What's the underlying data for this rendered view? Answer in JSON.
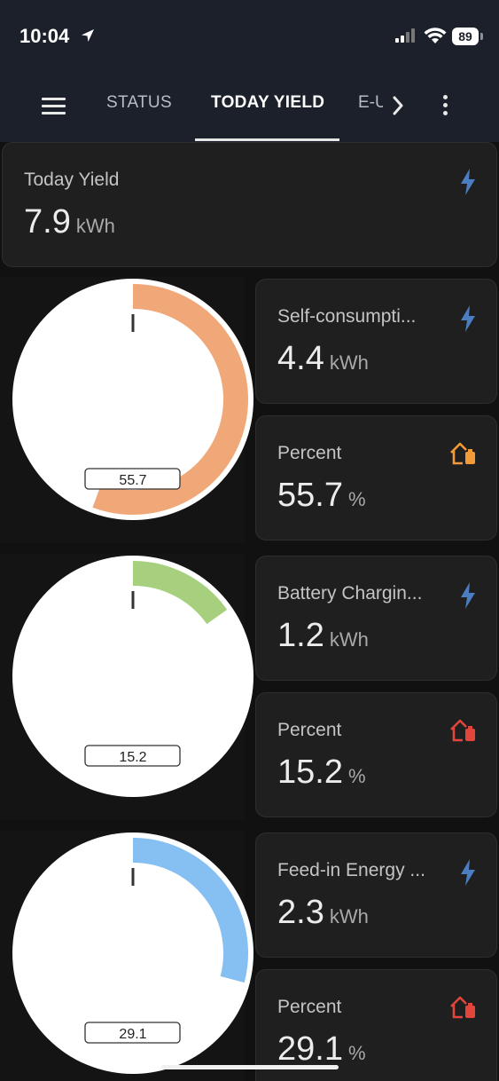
{
  "status_bar": {
    "time": "10:04",
    "battery": "89"
  },
  "app_bar": {
    "tabs": [
      {
        "label": "STATUS",
        "active": false
      },
      {
        "label": "TODAY YIELD",
        "active": true
      },
      {
        "label": "E-U",
        "active": false
      }
    ]
  },
  "summary": {
    "title": "Today Yield",
    "value": "7.9",
    "unit": "kWh",
    "icon": "lightning-icon"
  },
  "sections": [
    {
      "gauge": {
        "value": 55.7,
        "label": "55.7",
        "color": "#f0a878"
      },
      "energy": {
        "title": "Self-consumpti...",
        "value": "4.4",
        "unit": "kWh",
        "icon": "lightning-icon",
        "icon_color": "#4a7ec0"
      },
      "percent": {
        "title": "Percent",
        "value": "55.7",
        "unit": "%",
        "icon": "home-battery-icon",
        "icon_color": "#f29a38"
      }
    },
    {
      "gauge": {
        "value": 15.2,
        "label": "15.2",
        "color": "#a6d07e"
      },
      "energy": {
        "title": "Battery Chargin...",
        "value": "1.2",
        "unit": "kWh",
        "icon": "lightning-icon",
        "icon_color": "#4a7ec0"
      },
      "percent": {
        "title": "Percent",
        "value": "15.2",
        "unit": "%",
        "icon": "home-battery-icon",
        "icon_color": "#e2463b"
      }
    },
    {
      "gauge": {
        "value": 29.1,
        "label": "29.1",
        "color": "#86bff2"
      },
      "energy": {
        "title": "Feed-in Energy ...",
        "value": "2.3",
        "unit": "kWh",
        "icon": "lightning-icon",
        "icon_color": "#4a7ec0"
      },
      "percent": {
        "title": "Percent",
        "value": "29.1",
        "unit": "%",
        "icon": "home-battery-icon",
        "icon_color": "#e2463b"
      }
    }
  ]
}
